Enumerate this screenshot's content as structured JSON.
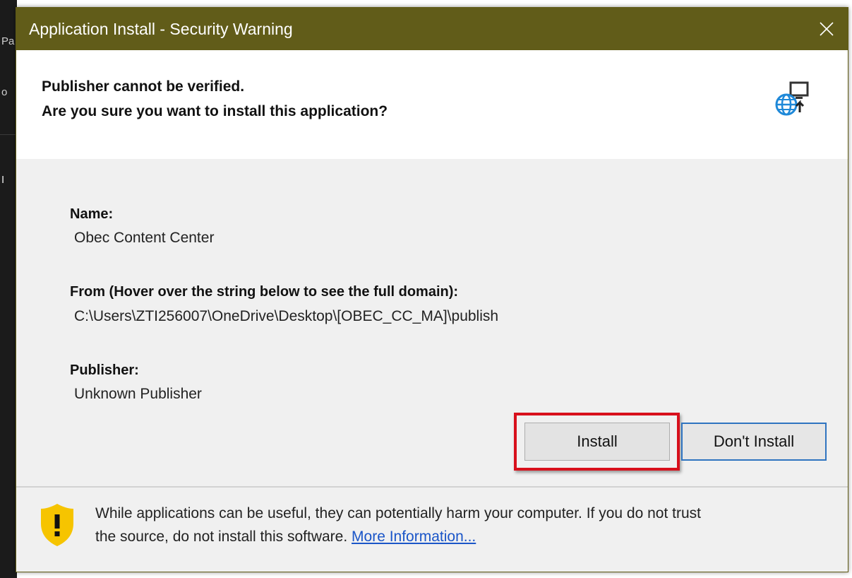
{
  "window": {
    "title": "Application Install - Security Warning"
  },
  "header": {
    "line1": "Publisher cannot be verified.",
    "line2": "Are you sure you want to install this application?",
    "icon": "web-app-install-icon"
  },
  "details": {
    "name_label": "Name:",
    "name_value": "Obec Content Center",
    "from_label": "From (Hover over the string below to see the full domain):",
    "from_value": "C:\\Users\\ZTI256007\\OneDrive\\Desktop\\[OBEC_CC_MA]\\publish",
    "publisher_label": "Publisher:",
    "publisher_value": "Unknown Publisher"
  },
  "buttons": {
    "install": "Install",
    "dont_install": "Don't Install"
  },
  "footer": {
    "line1": "While applications can be useful, they can potentially harm your computer. If you do not trust",
    "line2_prefix": "the source, do not install this software.",
    "more_info": "More Information...",
    "icon": "shield-warning-icon"
  },
  "background_fragments": [
    "Pa",
    "o",
    "I"
  ],
  "colors": {
    "titlebar": "#615c19",
    "highlight": "#d8101c",
    "link": "#1a55c8",
    "focus_border": "#2f74c0",
    "shield": "#f6c400"
  }
}
